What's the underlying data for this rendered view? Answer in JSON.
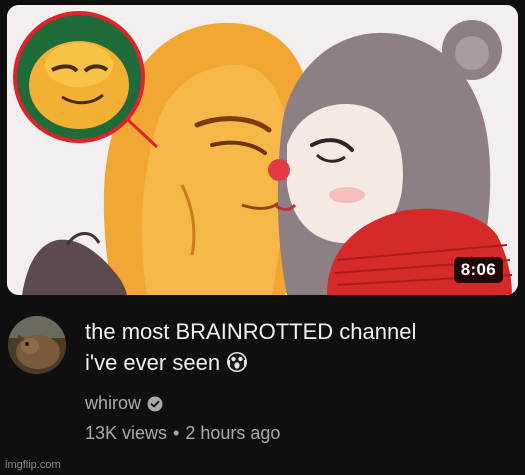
{
  "video": {
    "duration": "8:06",
    "title_line1": "the most BRAINROTTED channel",
    "title_line2": "i've ever seen",
    "title_emoji": "screaming-face-emoji",
    "channel_name": "whirow",
    "verified_icon": "verified-check-icon",
    "views": "13K views",
    "separator": "•",
    "age": "2 hours ago"
  },
  "watermark": "imgflip.com",
  "colors": {
    "background": "#0f0f0f",
    "title_text": "#f1f1f1",
    "secondary_text": "#aaaaaa",
    "highlight_circle": "#e0222a"
  }
}
